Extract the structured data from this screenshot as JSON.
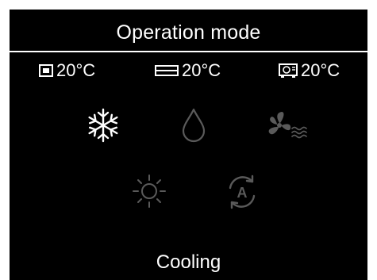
{
  "header": {
    "title": "Operation mode"
  },
  "temperatures": [
    {
      "icon": "indoor-unit-icon",
      "value": "20°C"
    },
    {
      "icon": "ceiling-unit-icon",
      "value": "20°C"
    },
    {
      "icon": "outdoor-unit-icon",
      "value": "20°C"
    }
  ],
  "modes": [
    {
      "name": "cooling",
      "icon": "snowflake-icon",
      "selected": true
    },
    {
      "name": "dry",
      "icon": "water-drop-icon",
      "selected": false
    },
    {
      "name": "fan",
      "icon": "fan-icon",
      "selected": false
    },
    {
      "name": "heating",
      "icon": "sun-icon",
      "selected": false
    },
    {
      "name": "auto",
      "icon": "auto-mode-icon",
      "selected": false
    }
  ],
  "status": {
    "label": "Cooling"
  },
  "colors": {
    "background": "#000000",
    "active": "#ffffff",
    "inactive": "#5a5a5a"
  }
}
